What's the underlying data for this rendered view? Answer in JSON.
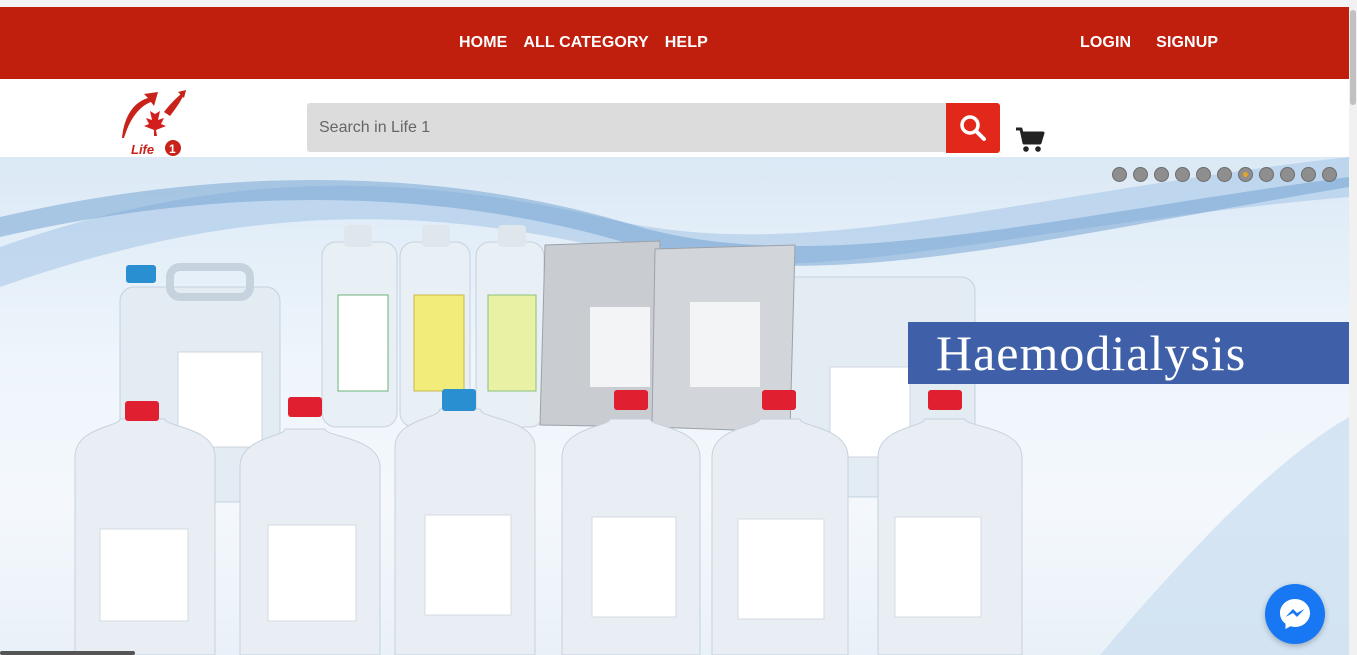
{
  "nav": {
    "links": [
      "HOME",
      "ALL CATEGORY",
      "HELP"
    ],
    "login": "LOGIN",
    "signup": "SIGNUP"
  },
  "header": {
    "logo_text": "Life 1",
    "search_placeholder": "Search in Life 1"
  },
  "banner": {
    "caption": "Haemodialysis",
    "slide_count": 11,
    "active_slide": 7
  },
  "icons": {
    "search": "search-icon",
    "cart": "cart-icon",
    "messenger": "messenger-icon"
  },
  "colors": {
    "nav_bg": "#c01f0e",
    "search_button": "#e2271b",
    "caption_bg": "#3f60a8",
    "messenger": "#1877f2"
  }
}
